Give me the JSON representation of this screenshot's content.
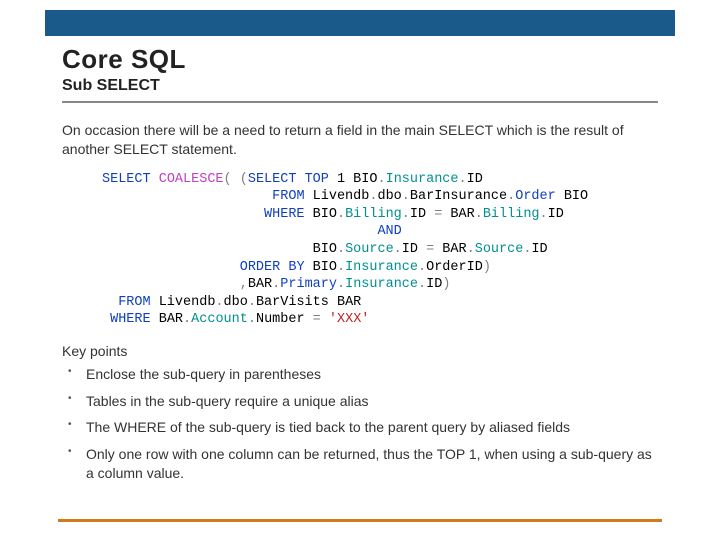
{
  "title": "Core SQL",
  "subtitle": "Sub SELECT",
  "intro": "On occasion there will be a need to return a field in the main SELECT which is the result of another SELECT statement.",
  "code": {
    "l1a": "SELECT",
    "l1b": "COALESCE",
    "l1c": "(",
    "l1d": " (",
    "l1e": "SELECT",
    "l1f": "TOP",
    "l1g": " 1 BIO",
    "l1h": ".",
    "l1i": "Insurance",
    "l1j": ".",
    "l1k": "ID",
    "l2a": "FROM",
    "l2b": " Livendb",
    "l2c": ".",
    "l2d": "dbo",
    "l2e": ".",
    "l2f": "BarInsurance",
    "l2g": ".",
    "l2h": "Order",
    "l2i": " BIO",
    "l3a": "WHERE",
    "l3b": " BIO",
    "l3c": ".",
    "l3d": "Billing",
    "l3e": ".",
    "l3f": "ID ",
    "l3g": "=",
    "l3h": " BAR",
    "l3i": ".",
    "l3j": "Billing",
    "l3k": ".",
    "l3l": "ID",
    "l4a": "AND",
    "l5a": "BIO",
    "l5b": ".",
    "l5c": "Source",
    "l5d": ".",
    "l5e": "ID ",
    "l5f": "=",
    "l5g": " BAR",
    "l5h": ".",
    "l5i": "Source",
    "l5j": ".",
    "l5k": "ID",
    "l6a": "ORDER BY",
    "l6b": " BIO",
    "l6c": ".",
    "l6d": "Insurance",
    "l6e": ".",
    "l6f": "OrderID",
    "l6g": ")",
    "l7a": ",",
    "l7b": "BAR",
    "l7c": ".",
    "l7d": "Primary",
    "l7e": ".",
    "l7f": "Insurance",
    "l7g": ".",
    "l7h": "ID",
    "l7i": ")",
    "l8a": "FROM",
    "l8b": " Livendb",
    "l8c": ".",
    "l8d": "dbo",
    "l8e": ".",
    "l8f": "BarVisits BAR",
    "l9a": "WHERE",
    "l9b": " BAR",
    "l9c": ".",
    "l9d": "Account",
    "l9e": ".",
    "l9f": "Number",
    "l9g": " = ",
    "l9h": "'XXX'"
  },
  "keypoints_label": "Key points",
  "bullets": [
    "Enclose the sub-query in parentheses",
    "Tables in the sub-query require a unique alias",
    "The WHERE of the sub-query is tied back to the parent query by aliased fields",
    "Only one row with one column can be returned, thus the TOP 1, when using a sub-query as a column value."
  ]
}
